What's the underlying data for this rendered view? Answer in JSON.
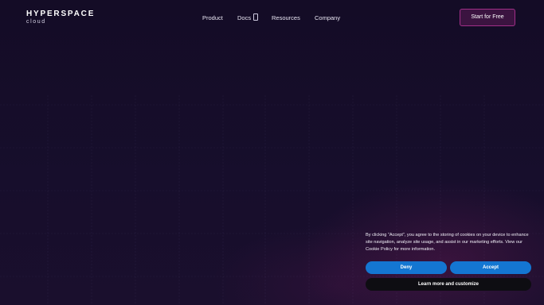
{
  "brand": {
    "name": "HYPERSPACE",
    "sub": "cloud"
  },
  "nav": {
    "items": [
      {
        "label": "Product"
      },
      {
        "label": "Docs"
      },
      {
        "label": "Resources"
      },
      {
        "label": "Company"
      }
    ],
    "cta_label": "Start for Free"
  },
  "cookie": {
    "text": "By clicking “Accept”, you agree to the storing of cookies on your device to enhance site navigation, analyze site usage, and assist in our marketing efforts. View our Cookie Policy for more information.",
    "deny_label": "Deny",
    "accept_label": "Accept",
    "more_label": "Learn more and customize"
  },
  "colors": {
    "background": "#150d29",
    "cta_border": "#a12f88",
    "button_blue": "#1476d2",
    "button_dark": "#0e0d12"
  }
}
